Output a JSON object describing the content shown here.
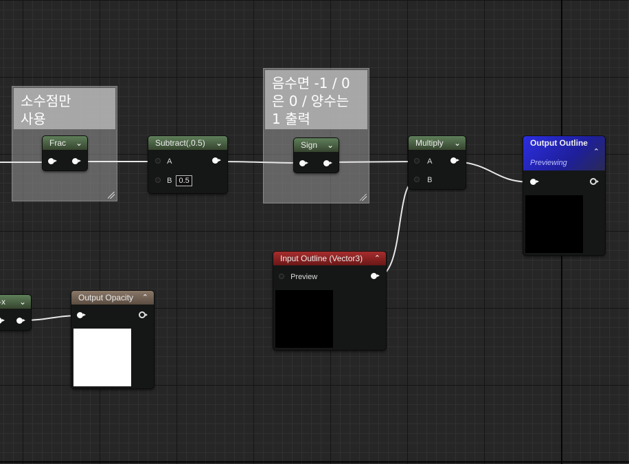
{
  "comments": [
    {
      "id": "c1",
      "text": "소수점만\n사용"
    },
    {
      "id": "c2",
      "text": "음수면 -1 / 0\n은 0 / 양수는\n1 출력"
    }
  ],
  "nodes": {
    "frac": {
      "title": "Frac"
    },
    "subtract": {
      "title": "Subtract(,0.5)",
      "pin_a": "A",
      "pin_b": "B",
      "b_value": "0.5"
    },
    "sign": {
      "title": "Sign"
    },
    "multiply": {
      "title": "Multiply",
      "pin_a": "A",
      "pin_b": "B"
    },
    "output_outline": {
      "title": "Output Outline",
      "subtitle": "Previewing",
      "preview_color": "#000000"
    },
    "input_outline": {
      "title": "Input Outline (Vector3)",
      "pin_label": "Preview",
      "preview_color": "#000000"
    },
    "output_opacity": {
      "title": "Output Opacity",
      "preview_color": "#ffffff"
    },
    "partial_node": {
      "title": "-x"
    }
  },
  "colors": {
    "math_header": "#4f6b49",
    "input_header": "#8e2222",
    "output_header": "#7a6a5c",
    "main_output_header": "#2628c8"
  },
  "icons": {
    "collapse": "chevron-down-icon",
    "expand": "chevron-up-icon",
    "resize": "resize-grip-icon"
  }
}
